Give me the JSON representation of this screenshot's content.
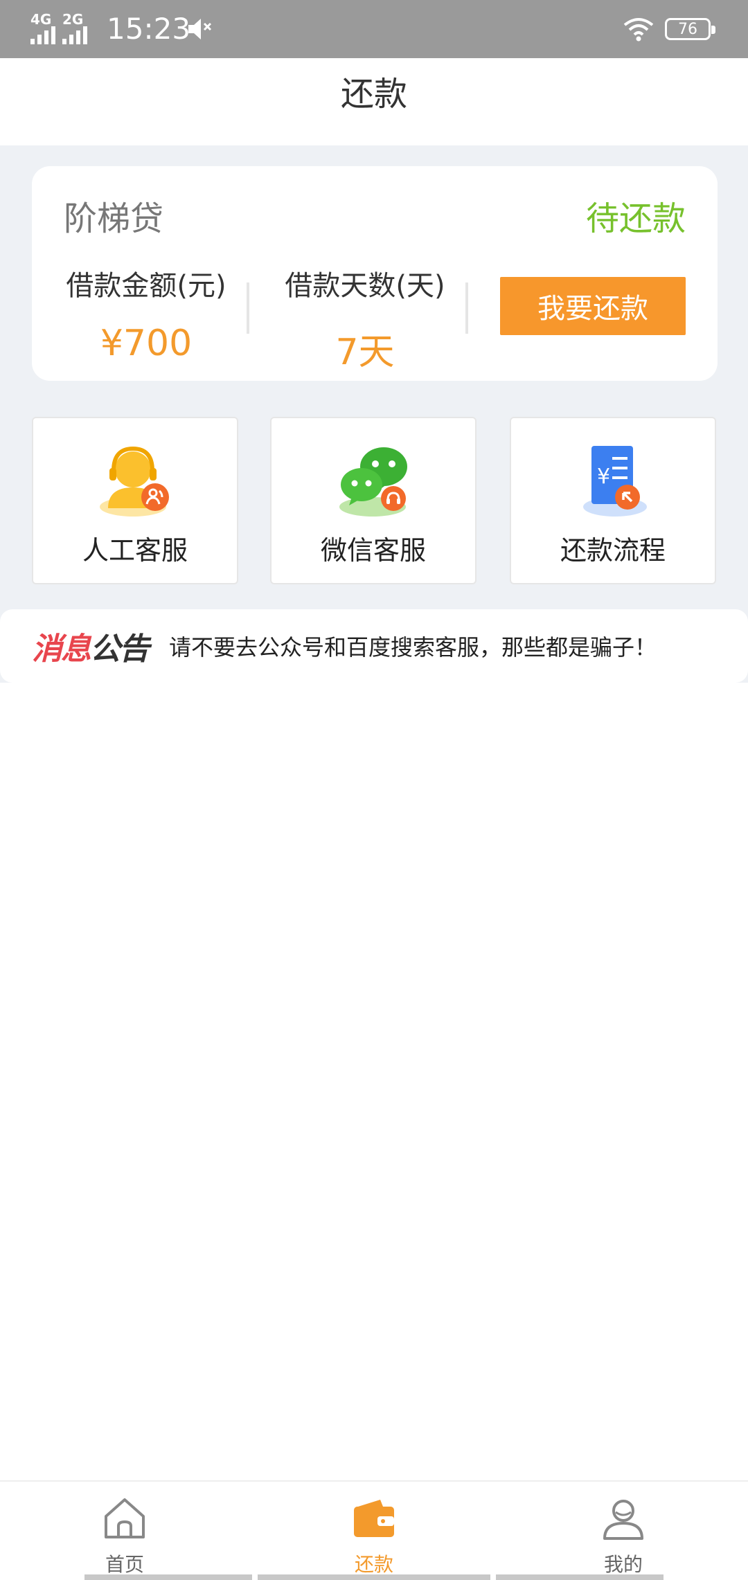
{
  "status_bar": {
    "net1": "4G",
    "net2": "2G",
    "time": "15:23",
    "battery": "76"
  },
  "header": {
    "title": "还款"
  },
  "loan_card": {
    "product_name": "阶梯贷",
    "status": "待还款",
    "amount_label": "借款金额(元)",
    "amount_value": "¥700",
    "days_label": "借款天数(天)",
    "days_value": "7天",
    "repay_button": "我要还款",
    "status_color": "#77c12d",
    "accent_color": "#f39a2c"
  },
  "services": [
    {
      "label": "人工客服",
      "icon": "customer-service-icon"
    },
    {
      "label": "微信客服",
      "icon": "wechat-icon"
    },
    {
      "label": "还款流程",
      "icon": "repayment-process-icon"
    }
  ],
  "notice": {
    "logo_part1": "消息",
    "logo_part2": "公告",
    "text": "请不要去公众号和百度搜索客服，那些都是骗子！"
  },
  "tabbar": {
    "items": [
      {
        "label": "首页",
        "icon": "home-icon",
        "active": false
      },
      {
        "label": "还款",
        "icon": "wallet-icon",
        "active": true
      },
      {
        "label": "我的",
        "icon": "user-icon",
        "active": false
      }
    ]
  }
}
